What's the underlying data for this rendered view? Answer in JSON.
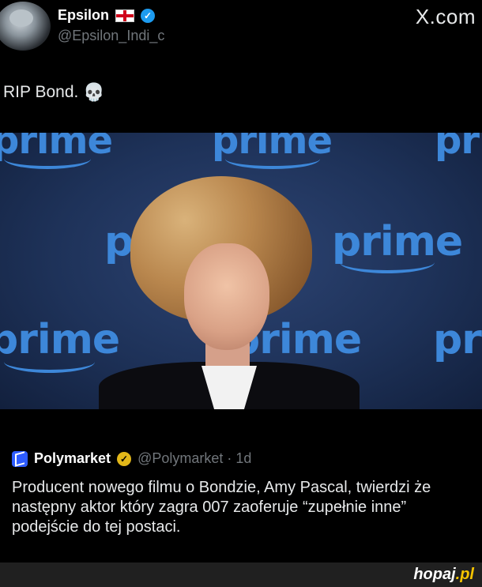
{
  "tweet": {
    "author_name": "Epsilon",
    "author_handle": "@Epsilon_Indi_c",
    "brand": "X.com",
    "text": "RIP Bond.",
    "emoji": "💀",
    "media": {
      "background_text": [
        "prime",
        "prime",
        "prime",
        "prime",
        "prime",
        "pri"
      ]
    }
  },
  "quoted": {
    "author_name": "Polymarket",
    "author_handle": "@Polymarket",
    "age": "1d",
    "text": "Producent nowego filmu o Bondzie, Amy Pascal, twierdzi że następny aktor który zagra 007 zaoferuje “zupełnie inne” podejście do tej postaci."
  },
  "watermark": {
    "main": "hopaj",
    "tld": ".pl"
  },
  "icons": {
    "flag": "england-flag-icon",
    "verified": "verified-badge-icon",
    "gold_verified": "gold-verified-badge-icon",
    "polymarket": "polymarket-logo-icon"
  },
  "colors": {
    "background": "#000000",
    "verified": "#1d9bf0",
    "gold": "#e2b719",
    "prime_blue": "#3d87d9",
    "watermark_accent": "#f5c400"
  }
}
